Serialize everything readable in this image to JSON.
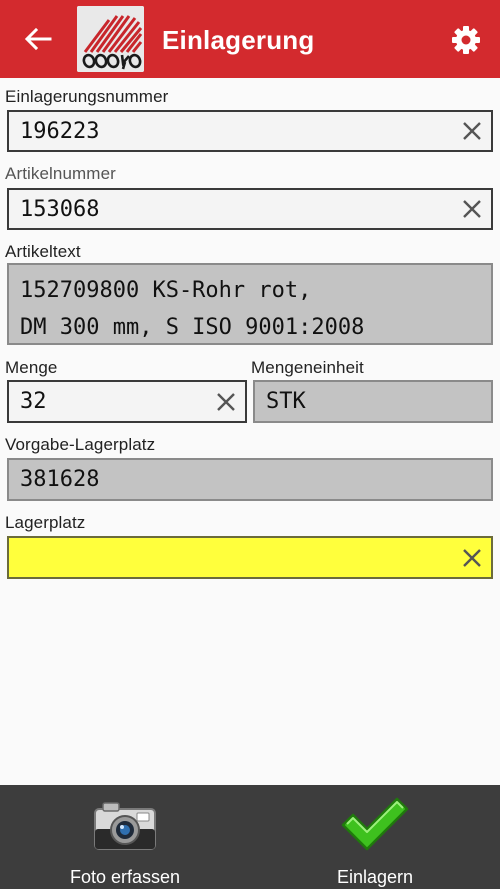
{
  "appbar": {
    "title": "Einlagerung",
    "back_icon": "arrow-left-icon",
    "settings_icon": "gear-icon",
    "color": "#d32a2e",
    "logo_text": "cosys"
  },
  "fields": {
    "einlagerungsnummer": {
      "label": "Einlagerungsnummer",
      "value": "196223"
    },
    "artikelnummer": {
      "label": "Artikelnummer",
      "value": "153068"
    },
    "artikeltext": {
      "label": "Artikeltext",
      "line1": "152709800 KS-Rohr rot,",
      "line2": "DM 300 mm, S ISO 9001:2008"
    },
    "menge": {
      "label": "Menge",
      "value": "32"
    },
    "mengeneinheit": {
      "label": "Mengeneinheit",
      "value": "STK"
    },
    "vorgabe_lagerplatz": {
      "label": "Vorgabe-Lagerplatz",
      "value": "381628"
    },
    "lagerplatz": {
      "label": "Lagerplatz",
      "value": "",
      "highlight": "#ffff3c"
    }
  },
  "bottombar": {
    "photo_label": "Foto erfassen",
    "photo_icon": "camera-icon",
    "store_label": "Einlagern",
    "store_icon": "checkmark-icon"
  }
}
